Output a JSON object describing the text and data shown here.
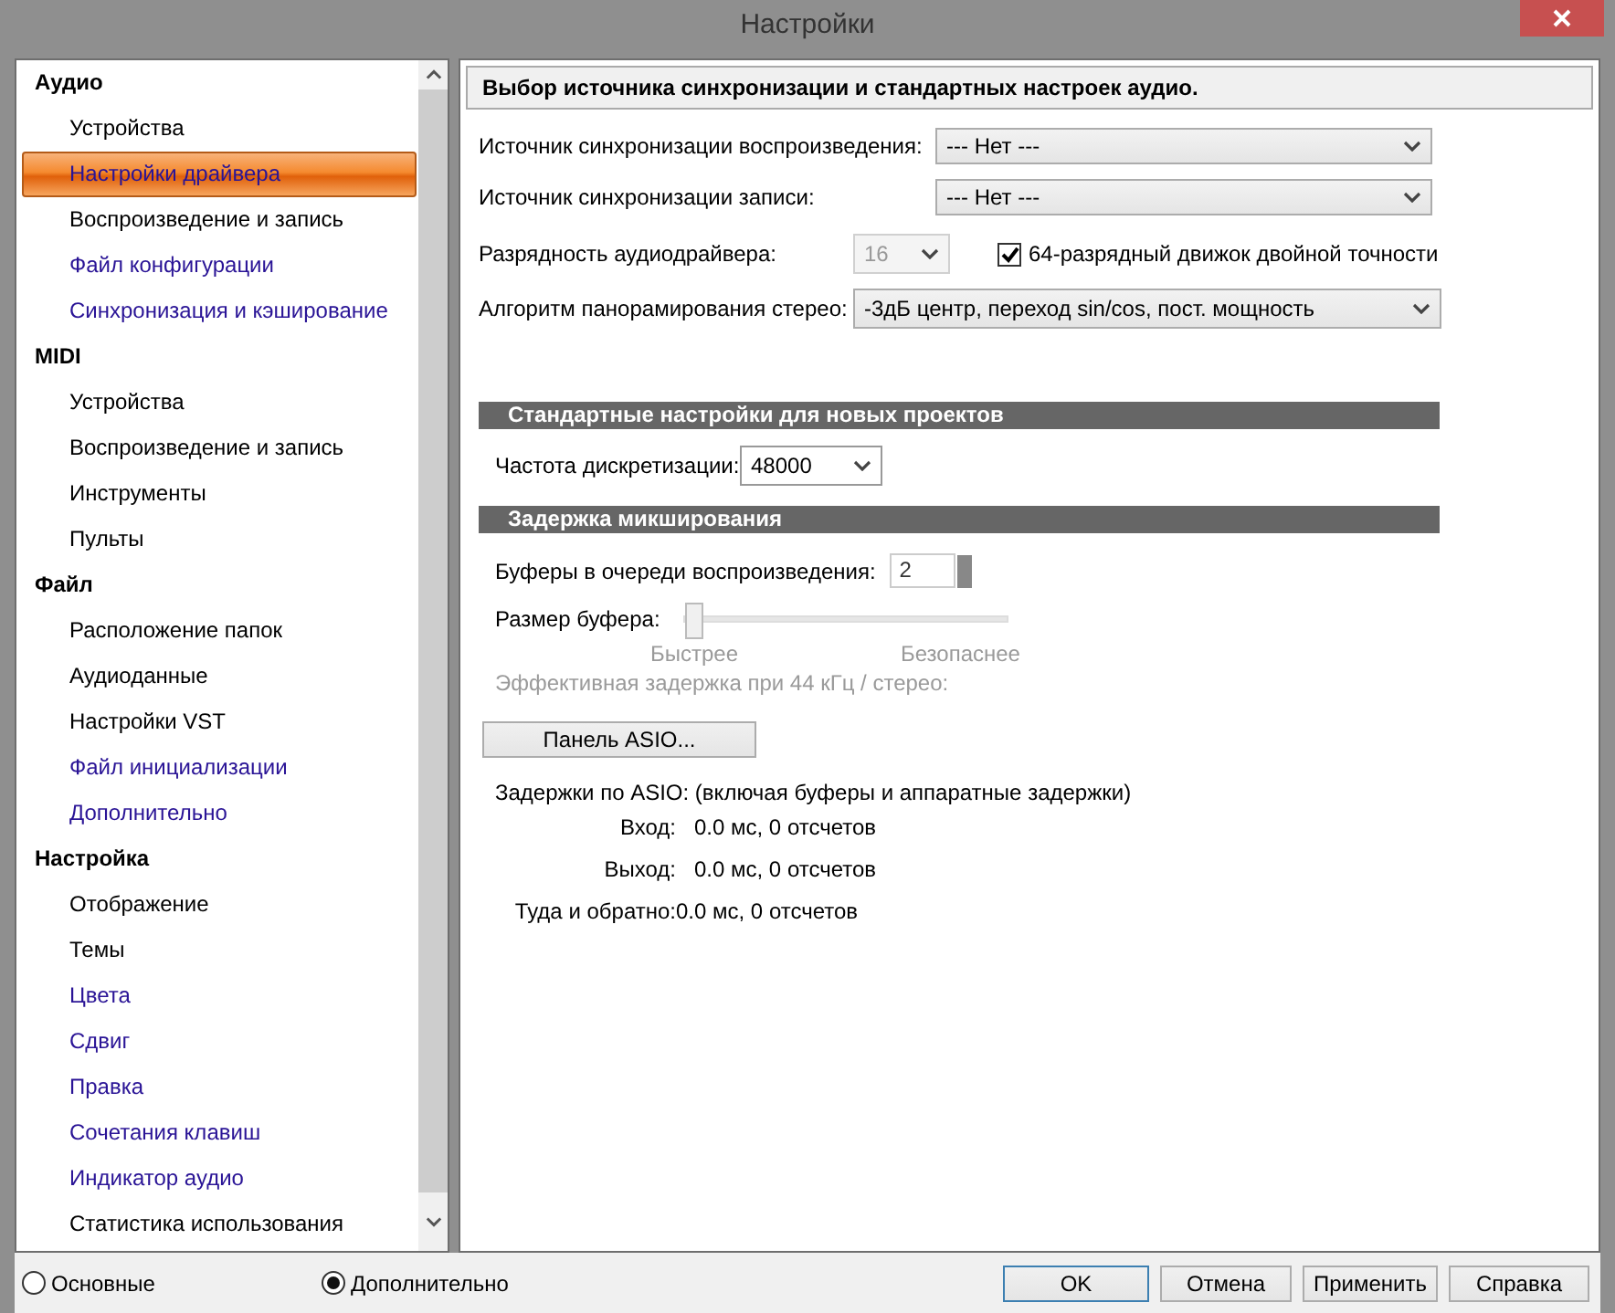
{
  "window": {
    "title": "Настройки"
  },
  "sidebar": {
    "groups": [
      {
        "label": "Аудио",
        "children": [
          {
            "label": "Устройства",
            "selected": false,
            "visited": false
          },
          {
            "label": "Настройки драйвера",
            "selected": true,
            "visited": true
          },
          {
            "label": "Воспроизведение и запись",
            "selected": false,
            "visited": false
          },
          {
            "label": "Файл конфигурации",
            "selected": false,
            "visited": true
          },
          {
            "label": "Синхронизация и кэширование",
            "selected": false,
            "visited": true
          }
        ]
      },
      {
        "label": "MIDI",
        "children": [
          {
            "label": "Устройства",
            "selected": false,
            "visited": false
          },
          {
            "label": "Воспроизведение и запись",
            "selected": false,
            "visited": false
          },
          {
            "label": "Инструменты",
            "selected": false,
            "visited": false
          },
          {
            "label": "Пульты",
            "selected": false,
            "visited": false
          }
        ]
      },
      {
        "label": "Файл",
        "children": [
          {
            "label": "Расположение папок",
            "selected": false,
            "visited": false
          },
          {
            "label": "Аудиоданные",
            "selected": false,
            "visited": false
          },
          {
            "label": "Настройки VST",
            "selected": false,
            "visited": false
          },
          {
            "label": "Файл инициализации",
            "selected": false,
            "visited": true
          },
          {
            "label": "Дополнительно",
            "selected": false,
            "visited": true
          }
        ]
      },
      {
        "label": "Настройка",
        "children": [
          {
            "label": "Отображение",
            "selected": false,
            "visited": false
          },
          {
            "label": "Темы",
            "selected": false,
            "visited": false
          },
          {
            "label": "Цвета",
            "selected": false,
            "visited": true
          },
          {
            "label": "Сдвиг",
            "selected": false,
            "visited": true
          },
          {
            "label": "Правка",
            "selected": false,
            "visited": true
          },
          {
            "label": "Сочетания клавиш",
            "selected": false,
            "visited": true
          },
          {
            "label": "Индикатор аудио",
            "selected": false,
            "visited": true
          },
          {
            "label": "Статистика использования",
            "selected": false,
            "visited": false
          }
        ]
      }
    ]
  },
  "panel": {
    "heading": "Выбор источника синхронизации и стандартных настроек аудио.",
    "sync_sources": [
      {
        "label": "Источник синхронизации воспроизведения:",
        "value": "--- Нет ---"
      },
      {
        "label": "Источник синхронизации записи:",
        "value": "--- Нет ---"
      }
    ],
    "bit_depth": {
      "label": "Разрядность аудиодрайвера:",
      "value": "16",
      "disabled": true
    },
    "double_precision": {
      "label": "64-разрядный движок двойной точности",
      "checked": true
    },
    "pan_law": {
      "label": "Алгоритм панорамирования стерео:",
      "value": "-3дБ центр, переход sin/cos, пост. мощность"
    },
    "new_projects": {
      "title": "Стандартные настройки для новых проектов",
      "sample_rate": {
        "label": "Частота дискретизации:",
        "value": "48000"
      }
    },
    "mixing_latency": {
      "title": "Задержка микширования",
      "buffers": {
        "label": "Буферы в очереди воспроизведения:",
        "value": "2"
      },
      "buffer_size": {
        "label": "Размер буфера:",
        "level": 0,
        "disabled": true,
        "min_label": "Быстрее",
        "max_label": "Безопаснее"
      },
      "effective_latency": "Эффективная задержка при 44 кГц / стерео:",
      "asio_button": "Панель ASIO...",
      "asio_heading": "Задержки по ASIO: (включая буферы и аппаратные задержки)",
      "latencies": [
        {
          "label": "Вход:",
          "value": "0.0 мс, 0 отсчетов"
        },
        {
          "label": "Выход:",
          "value": "0.0 мс, 0 отсчетов"
        },
        {
          "label": "Туда и обратно:",
          "value": "0.0 мс, 0 отсчетов"
        }
      ]
    }
  },
  "view_mode": [
    {
      "label": "Основные",
      "selected": false
    },
    {
      "label": "Дополнительно",
      "selected": true
    }
  ],
  "buttons": [
    {
      "label": "OK",
      "default": true
    },
    {
      "label": "Отмена",
      "default": false
    },
    {
      "label": "Применить",
      "default": false
    },
    {
      "label": "Справка",
      "default": false
    }
  ]
}
